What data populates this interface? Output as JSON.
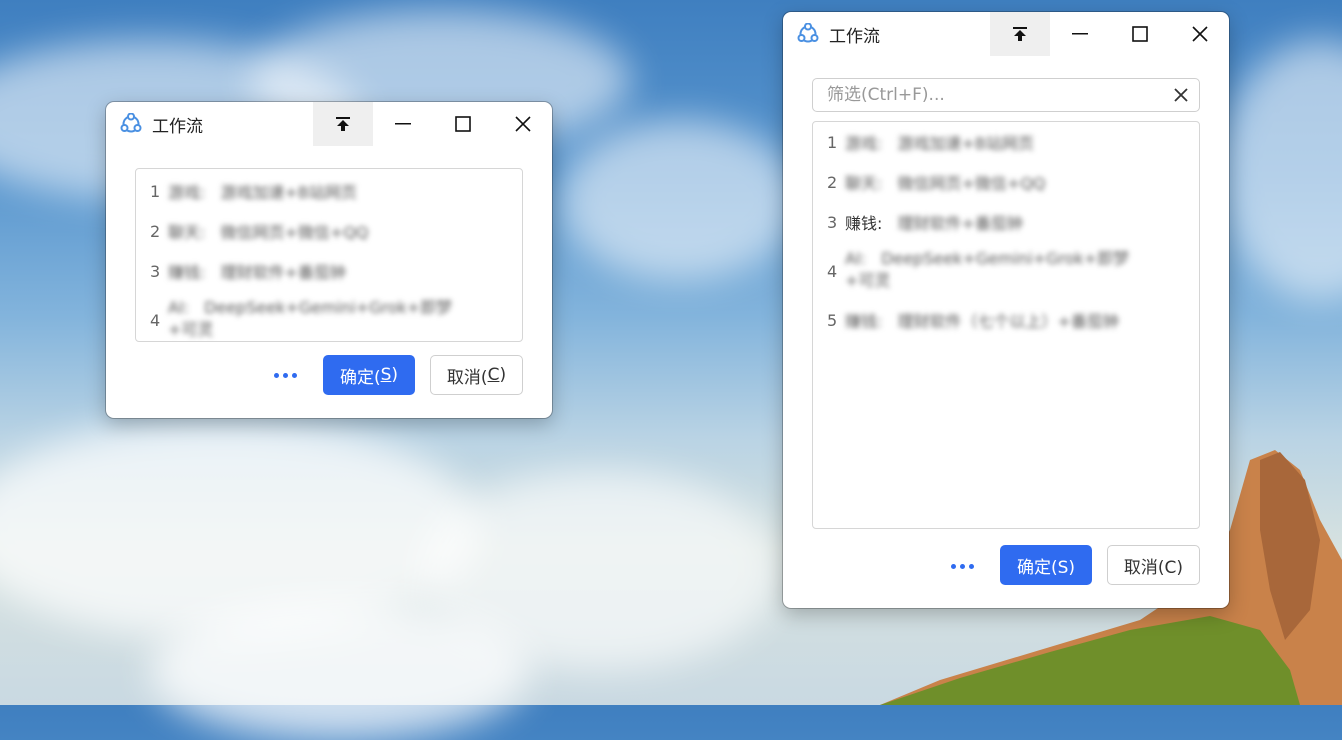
{
  "windows": [
    {
      "title": "工作流",
      "list": [
        {
          "num": "1",
          "head": "游戏:",
          "body": "游戏加速+B站网页"
        },
        {
          "num": "2",
          "head": "聊天:",
          "body": "微信网页+微信+QQ"
        },
        {
          "num": "3",
          "head": "赚钱:",
          "body": "理财软件+番茄钟"
        },
        {
          "num": "4",
          "head": "AI:",
          "body": "DeepSeek+Gemini+Grok+即梦",
          "body2": "+可灵"
        }
      ],
      "more_icon": "more-dots-icon",
      "ok_label": "确定(",
      "ok_key": "S",
      "ok_tail": ")",
      "cancel_label": "取消(",
      "cancel_key": "C",
      "cancel_tail": ")"
    },
    {
      "title": "工作流",
      "search_placeholder": "筛选(Ctrl+F)...",
      "list": [
        {
          "num": "1",
          "head": "游戏:",
          "body": "游戏加速+B站网页"
        },
        {
          "num": "2",
          "head": "聊天:",
          "body": "微信网页+微信+QQ"
        },
        {
          "num": "3",
          "head": "赚钱:",
          "body": "理财软件+番茄钟"
        },
        {
          "num": "4",
          "head": "AI:",
          "body": "DeepSeek+Gemini+Grok+即梦",
          "body2": "+可灵"
        },
        {
          "num": "5",
          "head": "赚钱:",
          "body": "理财软件（七个以上）+番茄钟"
        }
      ],
      "ok_label": "确定(S)",
      "cancel_label": "取消(C)"
    }
  ],
  "colors": {
    "accent": "#2f6bf0"
  }
}
